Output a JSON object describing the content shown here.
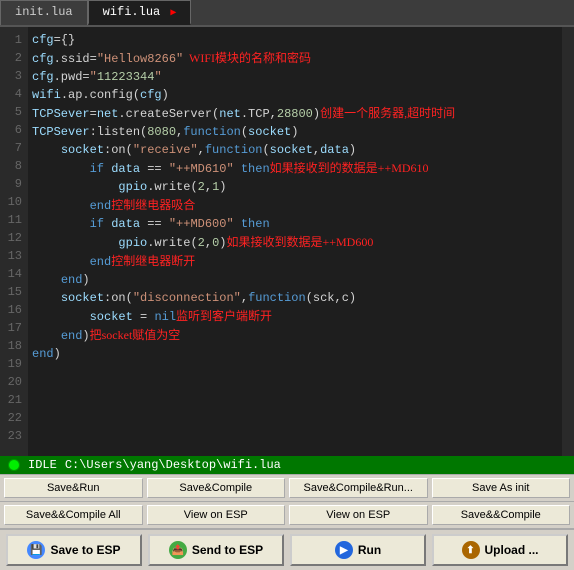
{
  "tabs": [
    {
      "id": "init-lua",
      "label": "init.lua",
      "active": false
    },
    {
      "id": "wifi-lua",
      "label": "wifi.lua",
      "active": true,
      "has_arrow": true
    }
  ],
  "code": {
    "lines": [
      {
        "num": 1,
        "text": "cfg={}"
      },
      {
        "num": 2,
        "text": "cfg.ssid=\"Hellow8266\"",
        "comment": "  WIFI模块的名称和密码",
        "comment_color": "red"
      },
      {
        "num": 3,
        "text": "cfg.pwd=\"11223344\""
      },
      {
        "num": 4,
        "text": "wifi.ap.config(cfg)"
      },
      {
        "num": 5,
        "text": ""
      },
      {
        "num": 6,
        "text": "TCPSever=net.createServer(net.TCP,28800)",
        "comment": "创建一个服务器,超时时间",
        "comment_color": "red"
      },
      {
        "num": 7,
        "text": ""
      },
      {
        "num": 8,
        "text": "TCPSever:listen(8080,function(socket)"
      },
      {
        "num": 9,
        "text": ""
      },
      {
        "num": 10,
        "text": "    socket:on(\"receive\",function(socket,data)"
      },
      {
        "num": 11,
        "text": "        if data == \"++MD610\" then",
        "comment": "如果接收到的数据是++MD610",
        "comment_color": "red"
      },
      {
        "num": 12,
        "text": "            gpio.write(2,1)"
      },
      {
        "num": 13,
        "text": "        end",
        "comment": "控制继电器吸合",
        "comment_color": "red"
      },
      {
        "num": 14,
        "text": "        if data == \"++MD600\" then"
      },
      {
        "num": 15,
        "text": "            gpio.write(2,0)",
        "comment": "如果接收到数据是++MD600",
        "comment_color": "red"
      },
      {
        "num": 16,
        "text": "        end",
        "comment": "控制继电器断开",
        "comment_color": "red"
      },
      {
        "num": 17,
        "text": "    end)"
      },
      {
        "num": 18,
        "text": ""
      },
      {
        "num": 19,
        "text": "    socket:on(\"disconnection\",function(sck,c)"
      },
      {
        "num": 20,
        "text": "        socket = nil",
        "comment": "监听到客户端断开",
        "comment_color": "red"
      },
      {
        "num": 21,
        "text": "    end)",
        "comment": "把socket赋值为空",
        "comment_color": "red"
      },
      {
        "num": 22,
        "text": "end)"
      },
      {
        "num": 23,
        "text": ""
      }
    ]
  },
  "status": {
    "mode": "IDLE",
    "file_path": "C:\\Users\\yang\\Desktop\\wifi.lua"
  },
  "toolbar1": {
    "btn1": "Save&Run",
    "btn2": "Save&Compile",
    "btn3": "Save&Compile&Run...",
    "btn4": "Save As init"
  },
  "toolbar2": {
    "btn1": "Save&&Compile All",
    "btn2": "View on ESP",
    "btn3": "View on ESP",
    "btn4": "Save&&Compile"
  },
  "actions": {
    "save_esp": "Save to ESP",
    "send_esp": "Send to ESP",
    "run": "Run",
    "upload": "Upload ..."
  }
}
